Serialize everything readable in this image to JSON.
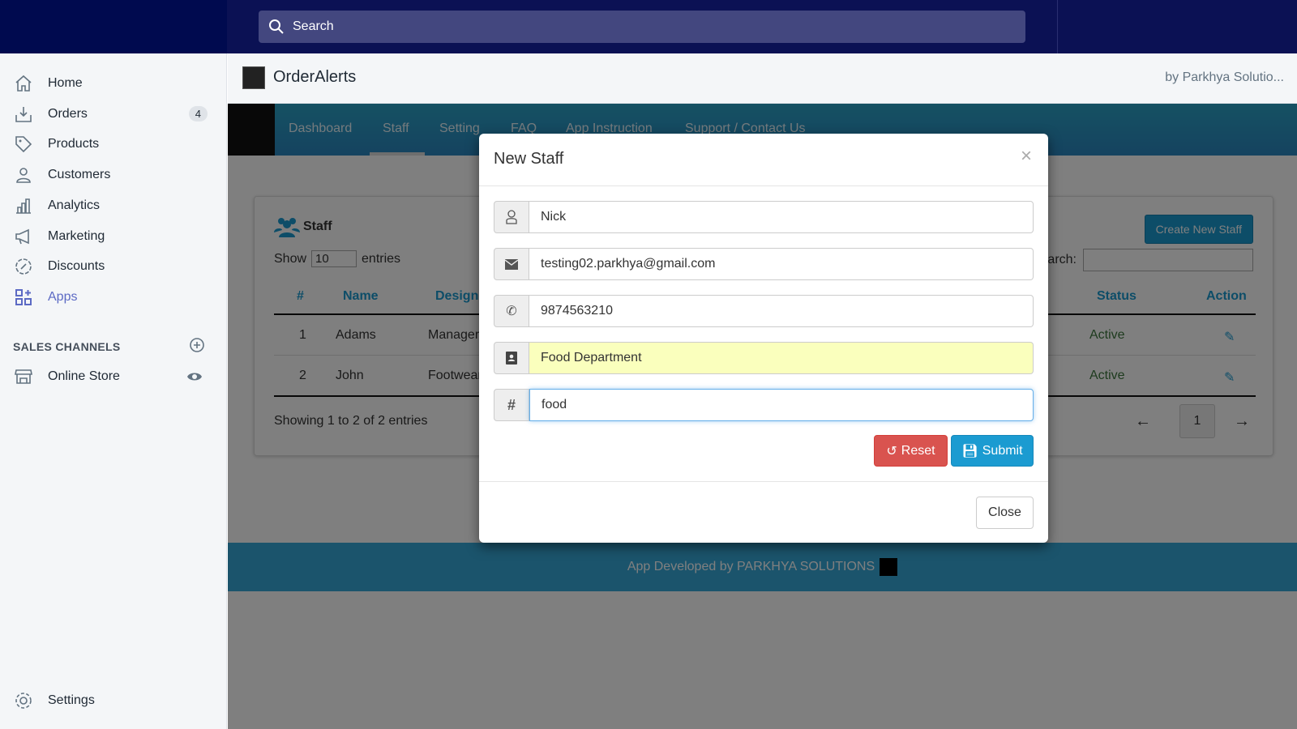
{
  "topbar": {
    "search_placeholder": "Search"
  },
  "sidebar": {
    "items": [
      {
        "label": "Home",
        "icon": "home-icon"
      },
      {
        "label": "Orders",
        "icon": "orders-icon",
        "badge": "4"
      },
      {
        "label": "Products",
        "icon": "tag-icon"
      },
      {
        "label": "Customers",
        "icon": "person-icon"
      },
      {
        "label": "Analytics",
        "icon": "bar-chart-icon"
      },
      {
        "label": "Marketing",
        "icon": "megaphone-icon"
      },
      {
        "label": "Discounts",
        "icon": "discount-icon"
      },
      {
        "label": "Apps",
        "icon": "apps-icon",
        "active": true
      }
    ],
    "sales_channels_heading": "SALES CHANNELS",
    "online_store": "Online Store",
    "settings": "Settings"
  },
  "app": {
    "title": "OrderAlerts",
    "by": "by Parkhya Solutio...",
    "nav": [
      "Dashboard",
      "Staff",
      "Setting",
      "FAQ",
      "App Instruction",
      "Support / Contact Us"
    ],
    "active_nav": "Staff",
    "card": {
      "title": "Staff",
      "show": "Show",
      "entries_value": "10",
      "entries": "entries",
      "create": "Create New Staff",
      "search_label": "Search:",
      "columns": [
        "#",
        "Name",
        "Design",
        "Status",
        "Action"
      ],
      "rows": [
        {
          "num": "1",
          "name": "Adams",
          "designation": "Manager",
          "status": "Active"
        },
        {
          "num": "2",
          "name": "John",
          "designation": "Footwear",
          "status": "Active"
        }
      ],
      "info": "Showing 1 to 2 of 2 entries",
      "page": "1"
    },
    "footer": "App Developed by PARKHYA SOLUTIONS"
  },
  "modal": {
    "title": "New Staff",
    "fields": [
      {
        "icon": "user-icon",
        "value": "Nick"
      },
      {
        "icon": "envelope-icon",
        "value": "testing02.parkhya@gmail.com"
      },
      {
        "icon": "phone-icon",
        "value": "9874563210"
      },
      {
        "icon": "contact-book-icon",
        "value": "Food Department"
      },
      {
        "icon": "hash-icon",
        "value": "food"
      }
    ],
    "reset": "Reset",
    "submit": "Submit",
    "close": "Close"
  },
  "colors": {
    "topbar": "#000a4f",
    "accent": "#1b9bd1",
    "danger": "#d9534f",
    "apps_active": "#5c6ac4"
  }
}
